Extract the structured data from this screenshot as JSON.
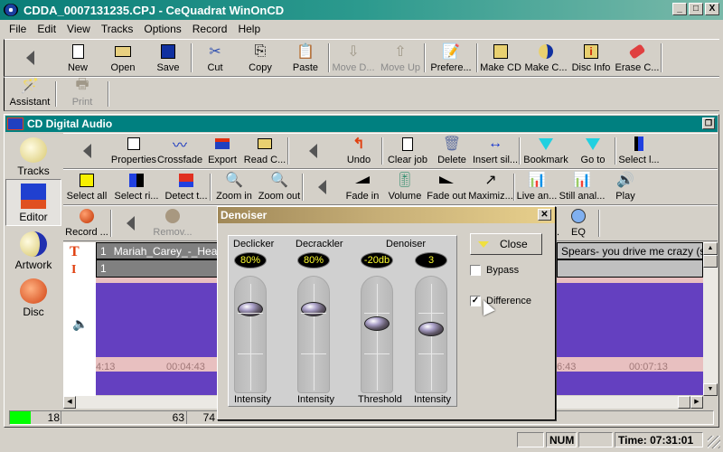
{
  "window": {
    "title": "CDDA_0007131235.CPJ - CeQuadrat WinOnCD",
    "controls": [
      "_",
      "□",
      "X"
    ]
  },
  "menu": [
    "File",
    "Edit",
    "View",
    "Tracks",
    "Options",
    "Record",
    "Help"
  ],
  "main_toolbar": {
    "buttons": [
      {
        "label": "New",
        "icon": "new-document-icon",
        "enabled": true
      },
      {
        "label": "Open",
        "icon": "open-folder-icon",
        "enabled": true
      },
      {
        "label": "Save",
        "icon": "save-disk-icon",
        "enabled": true
      },
      {
        "label": "Cut",
        "icon": "scissors-icon",
        "enabled": true
      },
      {
        "label": "Copy",
        "icon": "copy-icon",
        "enabled": true
      },
      {
        "label": "Paste",
        "icon": "paste-icon",
        "enabled": true
      },
      {
        "label": "Move D...",
        "icon": "move-down-icon",
        "enabled": false
      },
      {
        "label": "Move Up",
        "icon": "move-up-icon",
        "enabled": false
      },
      {
        "label": "Prefere...",
        "icon": "preferences-icon",
        "enabled": true
      },
      {
        "label": "Make CD",
        "icon": "make-cd-icon",
        "enabled": true
      },
      {
        "label": "Make C...",
        "icon": "make-cd-image-icon",
        "enabled": true
      },
      {
        "label": "Disc Info",
        "icon": "disc-info-icon",
        "enabled": true
      },
      {
        "label": "Erase C...",
        "icon": "erase-cd-icon",
        "enabled": true
      }
    ],
    "row2": [
      {
        "label": "Assistant",
        "icon": "magic-wand-icon",
        "enabled": true
      },
      {
        "label": "Print",
        "icon": "printer-icon",
        "enabled": false
      }
    ]
  },
  "child_window": {
    "title": "CD Digital Audio"
  },
  "sidebar": {
    "items": [
      {
        "label": "Tracks",
        "selected": false
      },
      {
        "label": "Editor",
        "selected": true
      },
      {
        "label": "Artwork",
        "selected": false
      },
      {
        "label": "Disc",
        "selected": false
      }
    ]
  },
  "editor_toolbar": {
    "row1_left": [
      "Properties",
      "Crossfade",
      "Export",
      "Read C..."
    ],
    "row1_right": [
      "Undo",
      "Clear job",
      "Delete",
      "Insert sil...",
      "Bookmark",
      "Go to",
      "Select l..."
    ],
    "row2_left": [
      "Select all",
      "Select ri...",
      "Detect t...",
      "Zoom in",
      "Zoom out"
    ],
    "row2_right": [
      "Fade in",
      "Volume",
      "Fade out",
      "Maximiz...",
      "Live an...",
      "Still anal...",
      "Play"
    ],
    "row3_left": [
      {
        "label": "Record ...",
        "enabled": true
      },
      {
        "label": "Remov...",
        "enabled": false
      }
    ],
    "row3_right": [
      "Vo...",
      "EQ"
    ]
  },
  "tracks": {
    "title_row": {
      "number": "1",
      "name_left": "Mariah_Carey_-_Heartbr",
      "name_right": "Spears- you drive me crazy (stop re"
    },
    "index_row": {
      "number": "1"
    },
    "timeline_left": [
      "4:13",
      "00:04:43"
    ],
    "timeline_right": [
      "6:43",
      "00:07:13"
    ]
  },
  "bottom_counters": {
    "level_percent": 18,
    "value1": "18",
    "value2": "63",
    "value3": "74"
  },
  "denoiser_dialog": {
    "title": "Denoiser",
    "close_label": "Close",
    "sections": [
      {
        "title": "Declicker",
        "value": "80%",
        "label": "Intensity",
        "level": 0.8
      },
      {
        "title": "Decrackler",
        "value": "80%",
        "label": "Intensity",
        "level": 0.8
      },
      {
        "title": "Denoiser",
        "value": "-20db",
        "label": "Threshold",
        "level": 0.55
      },
      {
        "title": "",
        "value": "3",
        "label": "Intensity",
        "level": 0.5
      }
    ],
    "bypass": {
      "label": "Bypass",
      "checked": false
    },
    "difference": {
      "label": "Difference",
      "checked": true
    }
  },
  "statusbar": {
    "num": "NUM",
    "time": "Time: 07:31:01"
  }
}
